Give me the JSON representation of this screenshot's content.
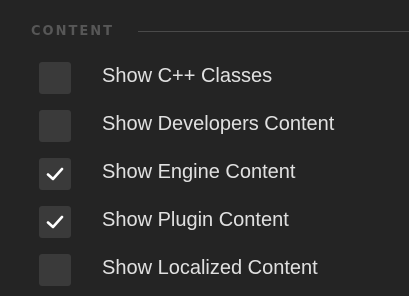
{
  "section": {
    "title": "CONTENT"
  },
  "options": [
    {
      "label": "Show C++ Classes",
      "checked": false
    },
    {
      "label": "Show Developers Content",
      "checked": false
    },
    {
      "label": "Show Engine Content",
      "checked": true
    },
    {
      "label": "Show Plugin Content",
      "checked": true
    },
    {
      "label": "Show Localized Content",
      "checked": false
    }
  ],
  "colors": {
    "background": "#242424",
    "checkbox": "#3a3a3a",
    "check_mark": "#ffffff",
    "label_text": "#e0e0e0",
    "section_title": "#575757"
  }
}
